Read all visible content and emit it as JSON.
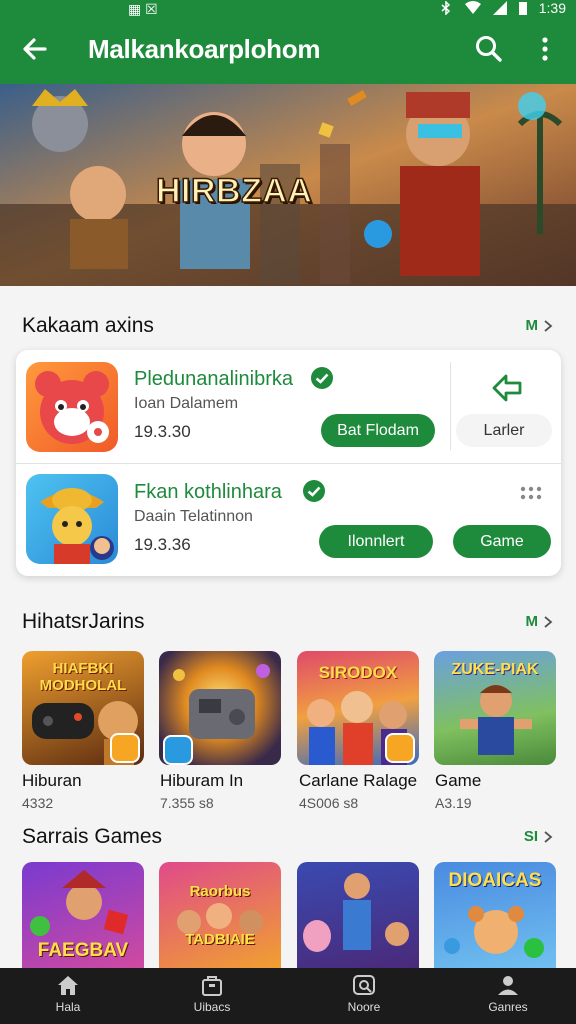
{
  "status": {
    "left_icons": "▦ ☒",
    "time": "1:39"
  },
  "appbar": {
    "title": "Malkankoarplohom",
    "back_icon": "arrow-left-icon",
    "search_icon": "search-icon",
    "more_icon": "more-vert-icon"
  },
  "banner": {
    "title": "HIRBZAA"
  },
  "section1": {
    "title": "Kakaam axins",
    "more": "M",
    "apps": [
      {
        "name": "Pledunanalinibrka",
        "sub": "Ioan Dalamem",
        "num": "19.3.30",
        "primary": "Bat Flodam",
        "secondary": "Larler"
      },
      {
        "name": "Fkan kothlinhara",
        "sub": "Daain Telatinnon",
        "num": "19.3.36",
        "primary": "Ilonnlert",
        "secondary": "Game"
      }
    ]
  },
  "section2": {
    "title": "HihatsrJarins",
    "more": "M",
    "tiles": [
      {
        "art": "HIAFBKI\nMODHOLAL",
        "label": "Hiburan",
        "count": "4332"
      },
      {
        "art": "",
        "label": "Hiburam In",
        "count": "7.355 s8"
      },
      {
        "art": "SIRODOX",
        "label": "Carlane Ralage",
        "count": "4S006 s8"
      },
      {
        "art": "ZUKE-PIAK",
        "label": "Game",
        "count": "A3.19"
      }
    ]
  },
  "section3": {
    "title": "Sarrais Games",
    "more": "SI",
    "tiles": [
      {
        "art": "FAEGBAV"
      },
      {
        "art": "Raorbus\nTADBIAIE"
      },
      {
        "art": ""
      },
      {
        "art": "DIOAICAS"
      }
    ]
  },
  "bottom_nav": [
    {
      "label": "Hala",
      "icon": "home-icon"
    },
    {
      "label": "Uibacs",
      "icon": "bag-icon"
    },
    {
      "label": "Noore",
      "icon": "gamepad-icon"
    },
    {
      "label": "Ganres",
      "icon": "person-icon"
    }
  ],
  "colors": {
    "primary": "#1e8a3c",
    "bg": "#f4f4f4",
    "nav": "#1b1b1b"
  }
}
